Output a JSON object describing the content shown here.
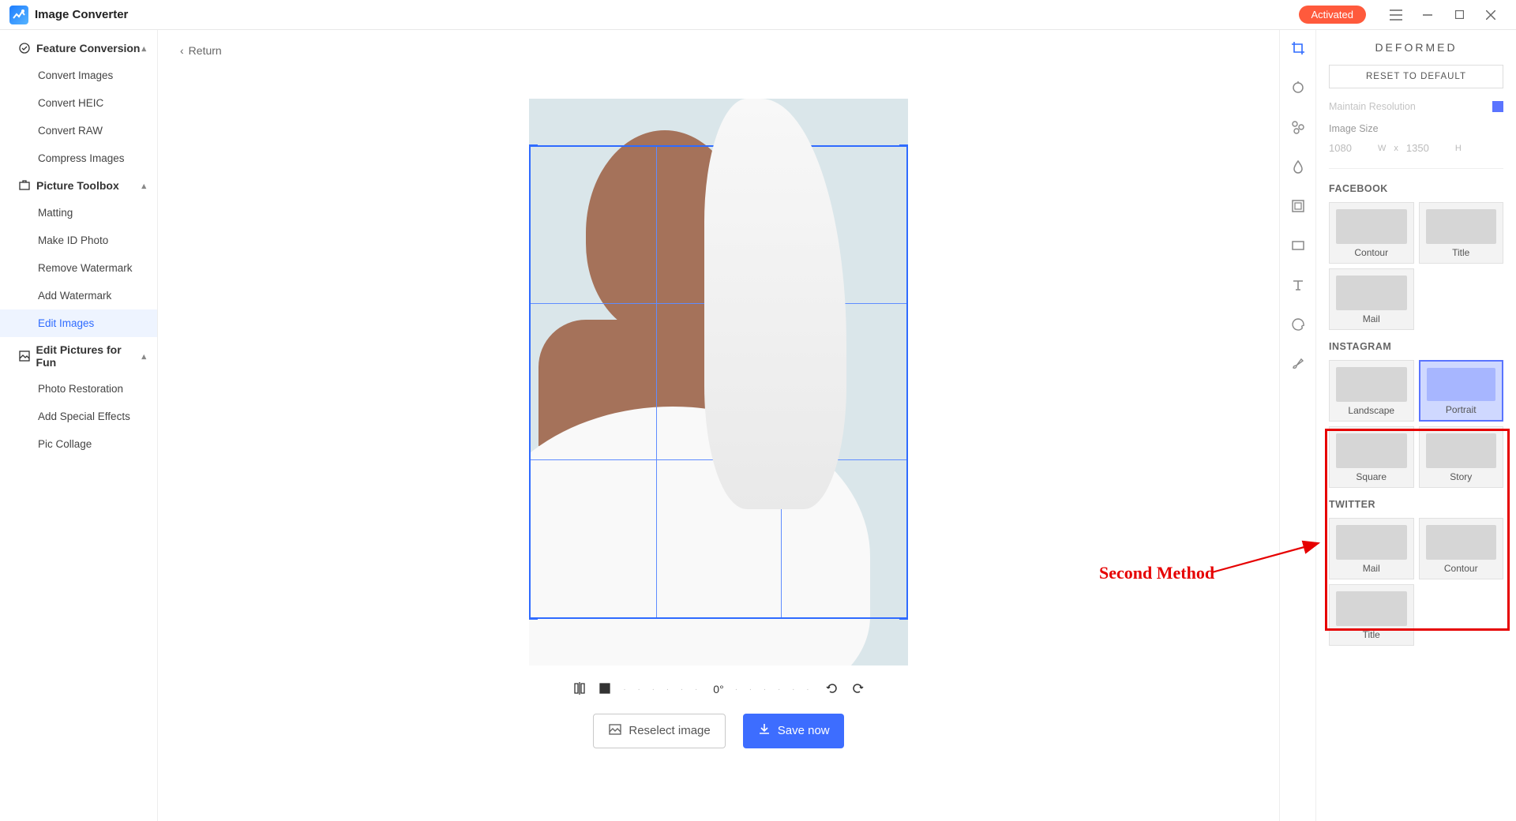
{
  "app": {
    "title": "Image Converter",
    "activated": "Activated"
  },
  "sidebar": {
    "sections": [
      {
        "label": "Feature Conversion",
        "items": [
          "Convert Images",
          "Convert HEIC",
          "Convert RAW",
          "Compress Images"
        ]
      },
      {
        "label": "Picture Toolbox",
        "items": [
          "Matting",
          "Make ID Photo",
          "Remove Watermark",
          "Add Watermark",
          "Edit Images"
        ]
      },
      {
        "label": "Edit Pictures for Fun",
        "items": [
          "Photo Restoration",
          "Add Special Effects",
          "Pic Collage"
        ]
      }
    ],
    "active": "Edit Images"
  },
  "main": {
    "return": "Return",
    "rotate_value": "0°",
    "reselect": "Reselect image",
    "save": "Save now"
  },
  "right": {
    "title": "DEFORMED",
    "reset": "RESET TO DEFAULT",
    "maintain_res": "Maintain Resolution",
    "image_size": "Image Size",
    "width": "1080",
    "w_label": "W",
    "height": "1350",
    "h_label": "H",
    "sep": "x",
    "sections": {
      "facebook": {
        "label": "FACEBOOK",
        "presets": [
          "Contour",
          "Title",
          "Mail"
        ]
      },
      "instagram": {
        "label": "INSTAGRAM",
        "presets": [
          "Landscape",
          "Portrait",
          "Square",
          "Story"
        ],
        "active": "Portrait"
      },
      "twitter": {
        "label": "TWITTER",
        "presets": [
          "Mail",
          "Contour",
          "Title"
        ]
      }
    }
  },
  "annotation": {
    "text": "Second Method"
  }
}
